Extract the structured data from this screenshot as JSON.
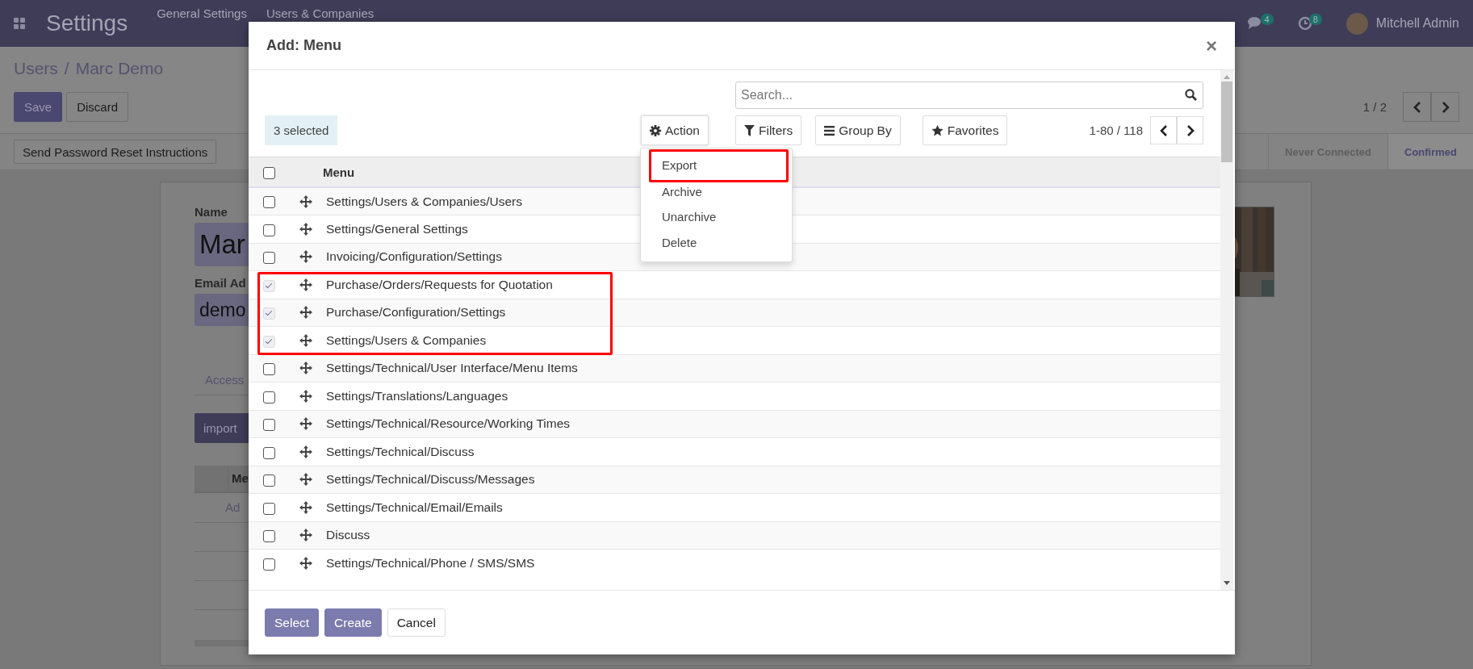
{
  "navbar": {
    "app_name": "Settings",
    "menus": [
      "General Settings",
      "Users & Companies"
    ],
    "chat_count": "4",
    "activity_count": "8",
    "user_name": "Mitchell Admin"
  },
  "control_panel": {
    "breadcrumb_parent": "Users",
    "breadcrumb_separator": "/",
    "breadcrumb_current": "Marc Demo",
    "buttons": [
      {
        "label": "Save",
        "kind": "primary"
      },
      {
        "label": "Discard",
        "kind": "secondary"
      }
    ],
    "pager": "1 / 2"
  },
  "status_row": {
    "button": "Send Password Reset Instructions",
    "stages": [
      {
        "label": "Never Connected",
        "selected": false
      },
      {
        "label": "Confirmed",
        "selected": true
      }
    ]
  },
  "form": {
    "fields": [
      {
        "label": "Name",
        "value": "Mar",
        "kind": "title"
      },
      {
        "label": "Email Ad",
        "value": "demo",
        "kind": "text"
      }
    ],
    "tab": "Access",
    "import_button": "import",
    "table_header": "Me",
    "add_link": "Ad"
  },
  "dialog": {
    "title": "Add: Menu",
    "close": "×",
    "search": {
      "placeholder": "Search..."
    },
    "selection": "3 selected",
    "action_button": "Action",
    "action_menu": [
      {
        "label": "Export",
        "highlighted": true
      },
      {
        "label": "Archive",
        "highlighted": false
      },
      {
        "label": "Unarchive",
        "highlighted": false
      },
      {
        "label": "Delete",
        "highlighted": false
      }
    ],
    "filters": [
      {
        "label": "Filters",
        "kind": "filter"
      },
      {
        "label": "Group By",
        "kind": "group"
      },
      {
        "label": "Favorites",
        "kind": "favorite"
      }
    ],
    "pager": "1-80 / 118",
    "column": "Menu",
    "all_checked": false,
    "rows": [
      {
        "name": "Settings/Users & Companies/Users",
        "checked": false,
        "highlighted": false
      },
      {
        "name": "Settings/General Settings",
        "checked": false,
        "highlighted": false
      },
      {
        "name": "Invoicing/Configuration/Settings",
        "checked": false,
        "highlighted": false
      },
      {
        "name": "Purchase/Orders/Requests for Quotation",
        "checked": true,
        "highlighted": true
      },
      {
        "name": "Purchase/Configuration/Settings",
        "checked": true,
        "highlighted": true
      },
      {
        "name": "Settings/Users & Companies",
        "checked": true,
        "highlighted": true
      },
      {
        "name": "Settings/Technical/User Interface/Menu Items",
        "checked": false,
        "highlighted": false
      },
      {
        "name": "Settings/Translations/Languages",
        "checked": false,
        "highlighted": false
      },
      {
        "name": "Settings/Technical/Resource/Working Times",
        "checked": false,
        "highlighted": false
      },
      {
        "name": "Settings/Technical/Discuss",
        "checked": false,
        "highlighted": false
      },
      {
        "name": "Settings/Technical/Discuss/Messages",
        "checked": false,
        "highlighted": false
      },
      {
        "name": "Settings/Technical/Email/Emails",
        "checked": false,
        "highlighted": false
      },
      {
        "name": "Discuss",
        "checked": false,
        "highlighted": false
      },
      {
        "name": "Settings/Technical/Phone / SMS/SMS",
        "checked": false,
        "highlighted": false
      }
    ],
    "footer_buttons": [
      {
        "label": "Select",
        "kind": "primary"
      },
      {
        "label": "Create",
        "kind": "primary"
      },
      {
        "label": "Cancel",
        "kind": "secondary"
      }
    ]
  }
}
